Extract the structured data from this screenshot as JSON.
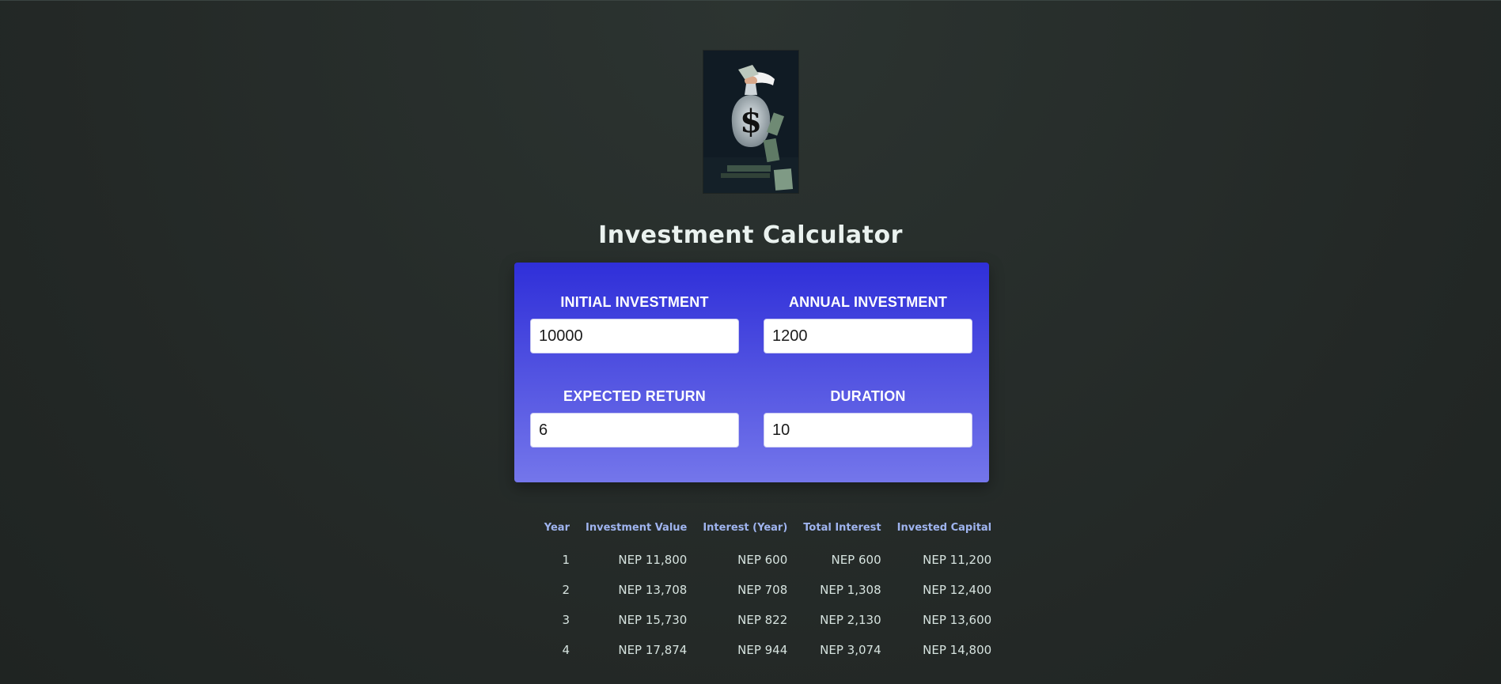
{
  "header": {
    "title": "Investment Calculator",
    "logo_icon": "money-bag-icon"
  },
  "inputs": {
    "initial_investment": {
      "label": "Initial Investment",
      "value": "10000"
    },
    "annual_investment": {
      "label": "Annual Investment",
      "value": "1200"
    },
    "expected_return": {
      "label": "Expected Return",
      "value": "6"
    },
    "duration": {
      "label": "Duration",
      "value": "10"
    }
  },
  "results": {
    "headers": [
      "Year",
      "Investment Value",
      "Interest (Year)",
      "Total Interest",
      "Invested Capital"
    ],
    "rows": [
      [
        "1",
        "NEP 11,800",
        "NEP 600",
        "NEP 600",
        "NEP 11,200"
      ],
      [
        "2",
        "NEP 13,708",
        "NEP 708",
        "NEP 1,308",
        "NEP 12,400"
      ],
      [
        "3",
        "NEP 15,730",
        "NEP 822",
        "NEP 2,130",
        "NEP 13,600"
      ],
      [
        "4",
        "NEP 17,874",
        "NEP 944",
        "NEP 3,074",
        "NEP 14,800"
      ]
    ]
  },
  "colors": {
    "background": "#262c2a",
    "card_top": "#2f2fd9",
    "card_bottom": "#7476eb",
    "table_header": "#9fb4ef",
    "table_text": "#d6e3df"
  }
}
